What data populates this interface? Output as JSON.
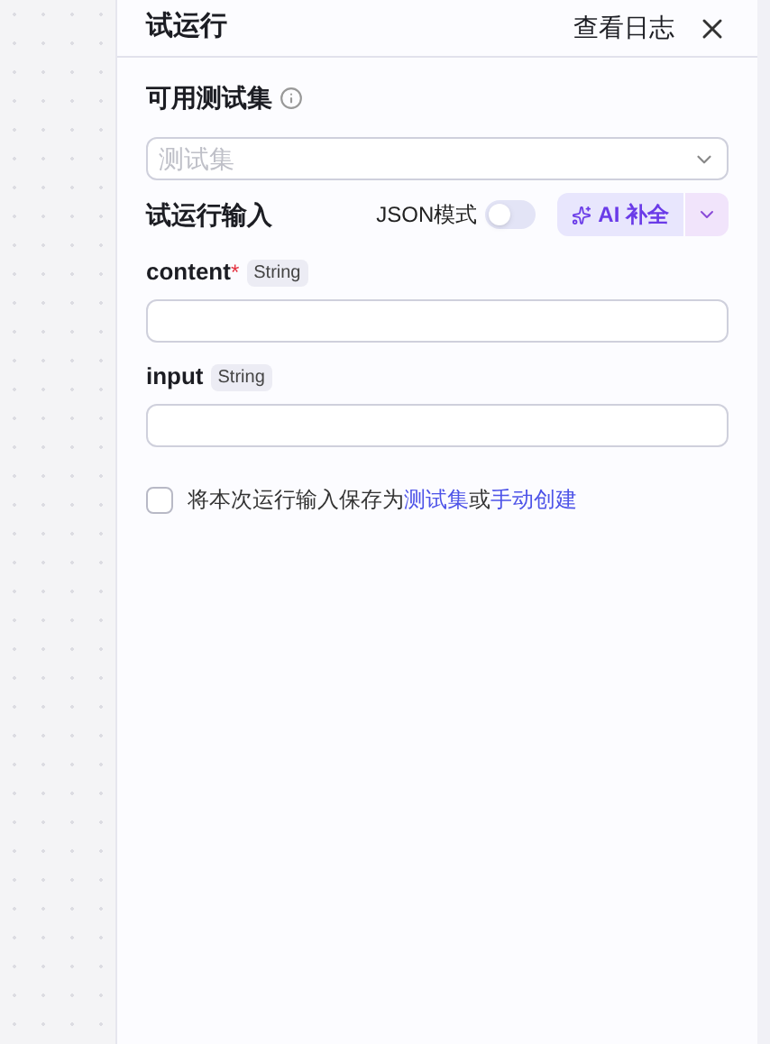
{
  "panel": {
    "title": "试运行",
    "log_link": "查看日志"
  },
  "testset": {
    "label": "可用测试集",
    "placeholder": "测试集"
  },
  "run_input": {
    "label": "试运行输入",
    "json_mode_label": "JSON模式",
    "json_mode": {
      "on": false
    },
    "ai_button": "AI 补全"
  },
  "fields": [
    {
      "name": "content",
      "required_mark": "*",
      "type": "String"
    },
    {
      "name": "input",
      "type": "String"
    }
  ],
  "save": {
    "checked": false,
    "text": "将本次运行输入保存为",
    "link1": "测试集",
    "or": "或",
    "link2": "手动创建"
  }
}
